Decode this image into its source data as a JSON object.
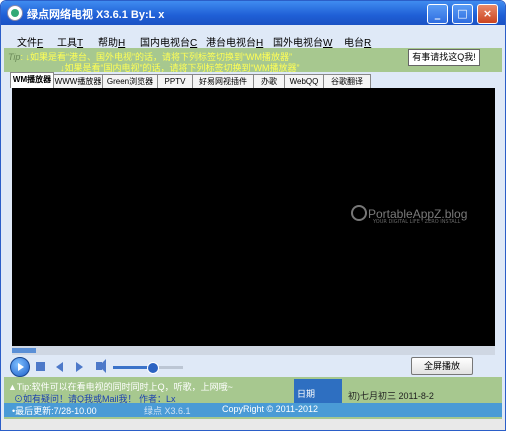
{
  "window": {
    "title": "绿点网络电视 X3.6.1 By:L x",
    "controls": [
      "_",
      "□",
      "×"
    ]
  },
  "menu": {
    "items": [
      {
        "label": "文件",
        "key": "F"
      },
      {
        "label": "工具",
        "key": "T"
      },
      {
        "label": "帮助",
        "key": "H"
      },
      {
        "label": "国内电视台",
        "key": "C"
      },
      {
        "label": "港台电视台",
        "key": "H"
      },
      {
        "label": "国外电视台",
        "key": "W"
      },
      {
        "label": "电台",
        "key": "R"
      }
    ]
  },
  "tips": {
    "label": "Tip",
    "line1": "↓如果是看“港台、国外电视”的话，请将下列标签切换到“WM播放器”",
    "line2": "↓如果是看“国内电视”的话，请将下列标签切换到“WM播放器”",
    "contact_button": "有事请找这Q我!"
  },
  "tabs": [
    "WM播放器",
    "WWW播放器",
    "Green浏览器",
    "PPTV",
    "好易网视插件",
    "办歌",
    "WebQQ",
    "谷歌翻译"
  ],
  "watermark": {
    "text": "PortableAppZ.blog",
    "sub": "YOUR DIGITAL LIFE · ZERO INSTALL"
  },
  "player": {
    "progress": 0.05,
    "volume": 0.55,
    "fullscreen_label": "全屏播放"
  },
  "bottom": {
    "tip": "▲Tip:软件可以在看电视的同时同时上Q，听歌，上网哦~",
    "contact": "⊙如有疑问！请Q我或Mail我！ 作者：Lx",
    "date_label": "日期",
    "date_value": "初)七月初三 2011-8-2"
  },
  "status": {
    "update": "•最后更新:7/28-10.00",
    "version": "绿点 X3.6.1",
    "copyright": "CopyRight © 2011-2012"
  },
  "colors": {
    "title_bar": "#1f5fd6",
    "tip_bg": "#a7c88f",
    "video_bg": "#000000",
    "status_bg": "#4a9bd6"
  }
}
